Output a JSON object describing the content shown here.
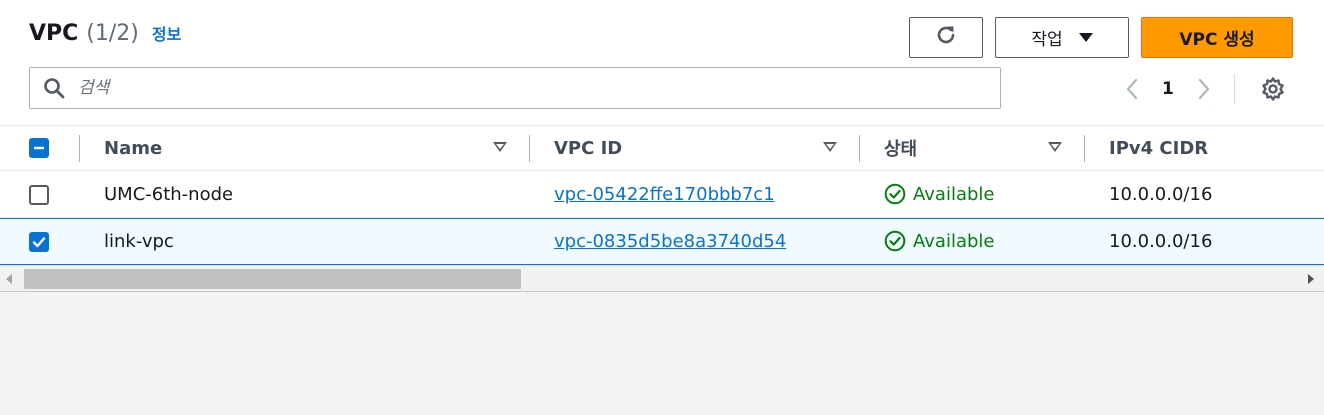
{
  "header": {
    "title": "VPC",
    "count": "(1/2)",
    "info_link": "정보"
  },
  "toolbar": {
    "refresh_icon": "refresh-icon",
    "actions_label": "작업",
    "create_label": "VPC 생성",
    "create_color": "#ff9900"
  },
  "search": {
    "placeholder": "검색",
    "value": ""
  },
  "pagination": {
    "current_page": "1"
  },
  "table": {
    "columns": [
      "Name",
      "VPC ID",
      "상태",
      "IPv4 CIDR"
    ],
    "rows": [
      {
        "selected": false,
        "name": "UMC-6th-node",
        "vpc_id": "vpc-05422ffe170bbb7c1",
        "status": "Available",
        "cidr": "10.0.0.0/16"
      },
      {
        "selected": true,
        "name": "link-vpc",
        "vpc_id": "vpc-0835d5be8a3740d54",
        "status": "Available",
        "cidr": "10.0.0.0/16"
      }
    ]
  },
  "colors": {
    "link": "#0972d3",
    "success": "#037f0c",
    "selected_row_bg": "#f1faff"
  }
}
